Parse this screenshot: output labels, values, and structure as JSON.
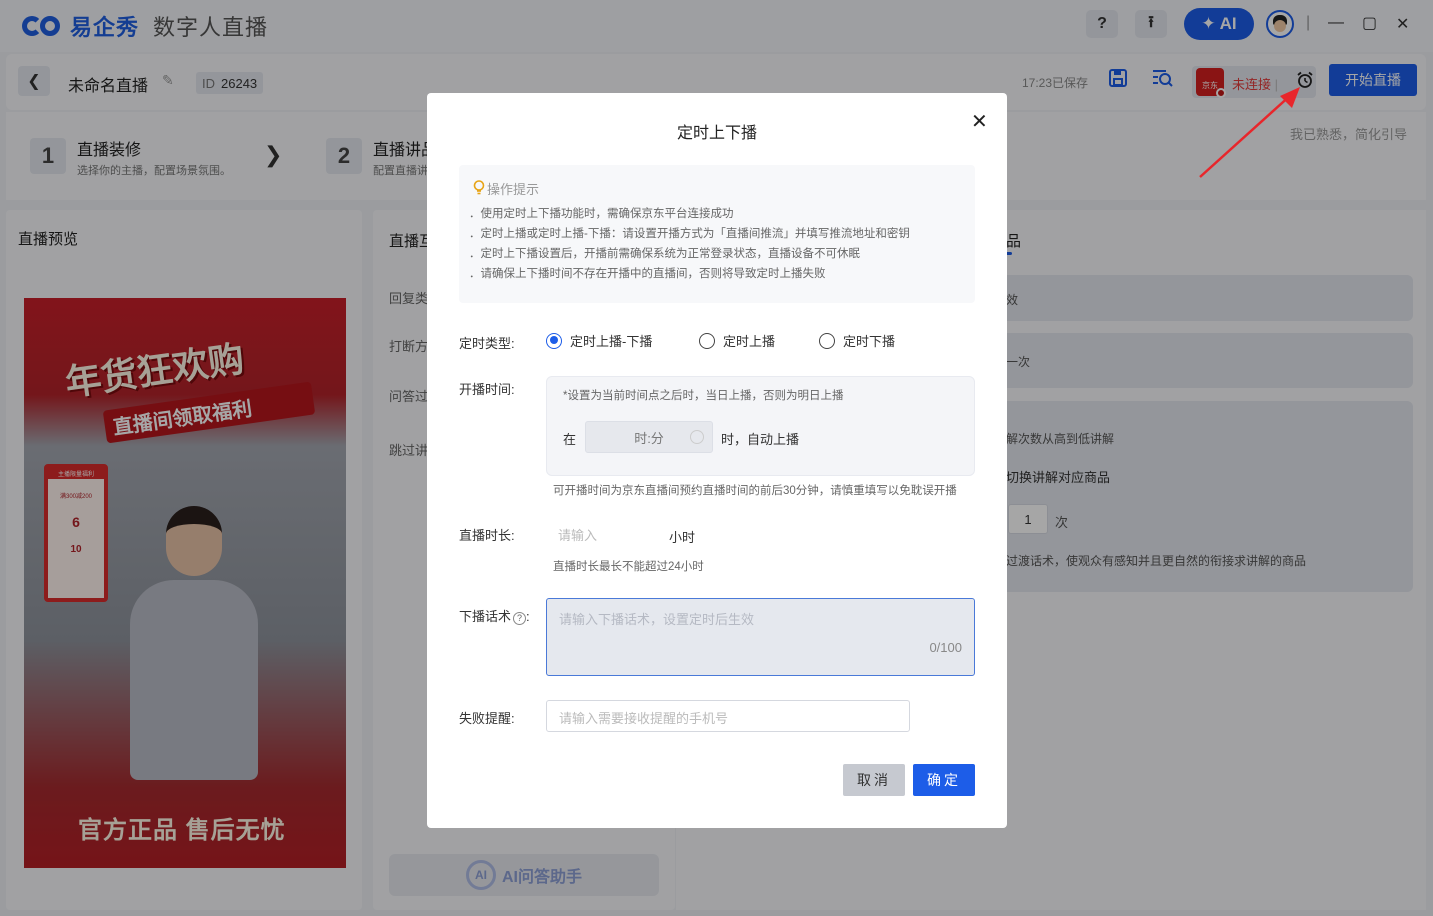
{
  "app": {
    "brand": "易企秀",
    "product": "数字人直播"
  },
  "titlebar": {
    "help": "?",
    "upload": "⭱",
    "ai_label": "AI",
    "ai_spark": "✦",
    "minimize": "—",
    "maximize": "▢",
    "close": "✕"
  },
  "header": {
    "back": "❮",
    "live_name": "未命名直播",
    "edit": "✎",
    "id_label": "ID",
    "id_value": "26243",
    "saved_text": "17:23已保存",
    "save_icon": "💾",
    "preview_icon": "⌕",
    "jd_label": "京东",
    "jd_status": "未连接",
    "jd_sep": "|",
    "alarm_icon": "⏰",
    "start_button": "开始直播"
  },
  "steps": [
    {
      "num": "1",
      "title": "直播装修",
      "desc": "选择你的主播，配置场景氛围。"
    },
    {
      "num": "2",
      "title": "直播讲品",
      "desc": "配置直播讲"
    }
  ],
  "step_arrow": "❯",
  "guide_link": "我已熟悉，简化引导",
  "preview": {
    "title": "直播预览",
    "banner_main": "年货狂欢购",
    "banner_sub": "直播间领取福利",
    "coupon_top": "主播限量福利",
    "coupon_line1": "满300减200",
    "coupon_value1": "6",
    "coupon_value2": "10",
    "floor_text": "官方正品 售后无忧"
  },
  "middle": {
    "title": "直播互",
    "items": [
      "回复类",
      "打断方",
      "问答过",
      "跳过讲"
    ],
    "ai_assist_ring": "AI",
    "ai_assist_label": "AI问答助手"
  },
  "right": {
    "title": "品",
    "row1": "效",
    "row2": "一次",
    "text1": "解次数从高到低讲解",
    "text2": "切换讲解对应商品",
    "count_value": "1",
    "count_unit": "次",
    "text3": "过渡话术，使观众有感知并且更自然的衔接求讲解的商品"
  },
  "modal": {
    "title": "定时上下播",
    "close": "✕",
    "tips_title": "操作提示",
    "tips_icon": "💡",
    "tips": [
      "．使用定时上下播功能时，需确保京东平台连接成功",
      "．定时上播或定时上播-下播：请设置开播方式为「直播间推流」并填写推流地址和密钥",
      "．定时上下播设置后，开播前需确保系统为正常登录状态，直播设备不可休眠",
      "．请确保上下播时间不存在开播中的直播间，否则将导致定时上播失败"
    ],
    "type_label": "定时类型:",
    "type_options": [
      {
        "label": "定时上播-下播",
        "checked": true
      },
      {
        "label": "定时上播",
        "checked": false
      },
      {
        "label": "定时下播",
        "checked": false
      }
    ],
    "start_time_label": "开播时间:",
    "start_time_note": "*设置为当前时间点之后时，当日上播，否则为明日上播",
    "start_time_prefix": "在",
    "start_time_placeholder": "时:分",
    "start_time_suffix": "时，自动上播",
    "start_time_hint": "可开播时间为京东直播间预约直播时间的前后30分钟，请慎重填写以免耽误开播",
    "duration_label": "直播时长:",
    "duration_placeholder": "请输入",
    "duration_unit": "小时",
    "duration_hint": "直播时长最长不能超过24小时",
    "script_label": "下播话术",
    "script_help": "?",
    "script_colon": ":",
    "script_placeholder": "请输入下播话术，设置定时后生效",
    "script_count": "0/100",
    "fail_label": "失败提醒:",
    "fail_placeholder": "请输入需要接收提醒的手机号",
    "cancel": "取消",
    "ok": "确定"
  },
  "colors": {
    "accent": "#1d5de8",
    "danger": "#e23b3b",
    "annotation_arrow": "#e8262b"
  }
}
